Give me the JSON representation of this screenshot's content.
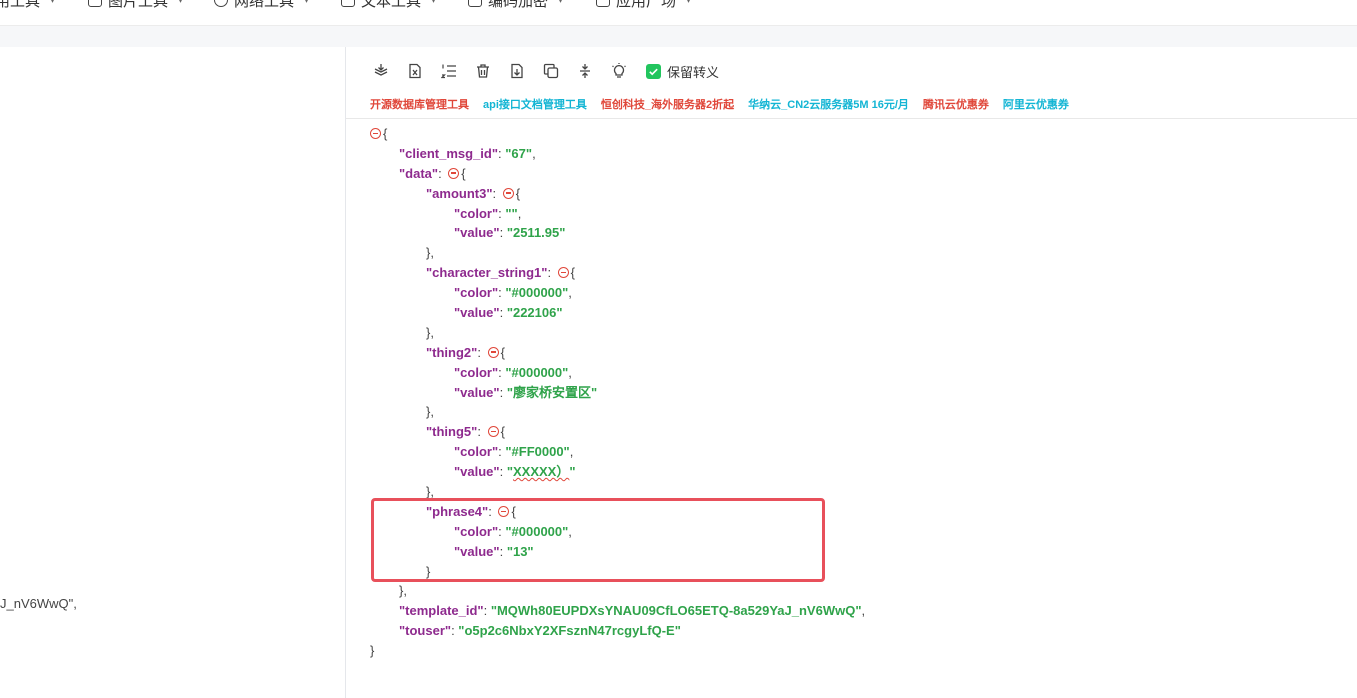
{
  "topnav": {
    "items": [
      {
        "label": "用工具",
        "icon": "toolbox-icon"
      },
      {
        "label": "图片工具",
        "icon": "image-icon"
      },
      {
        "label": "网络工具",
        "icon": "globe-icon"
      },
      {
        "label": "文本工具",
        "icon": "text-icon"
      },
      {
        "label": "编码加密",
        "icon": "lock-icon"
      },
      {
        "label": "应用广场",
        "icon": "grid-icon"
      }
    ]
  },
  "left_panel": {
    "visible_text": "J_nV6WwQ\","
  },
  "toolbar": {
    "buttons": [
      {
        "name": "compress-icon"
      },
      {
        "name": "excel-icon"
      },
      {
        "name": "list-icon"
      },
      {
        "name": "delete-icon"
      },
      {
        "name": "download-icon"
      },
      {
        "name": "copy-icon"
      },
      {
        "name": "collapse-icon"
      },
      {
        "name": "bulb-icon"
      }
    ],
    "keep_escape_label": "保留转义",
    "keep_escape_checked": true
  },
  "ads": [
    {
      "label": "开源数据库管理工具",
      "color": "#e0473a"
    },
    {
      "label": "api接口文档管理工具",
      "color": "#13b5d4"
    },
    {
      "label": "恒创科技_海外服务器2折起",
      "color": "#e0473a"
    },
    {
      "label": "华纳云_CN2云服务器5M 16元/月",
      "color": "#13b5d4"
    },
    {
      "label": "腾讯云优惠券",
      "color": "#e0473a"
    },
    {
      "label": "阿里云优惠券",
      "color": "#13b5d4"
    }
  ],
  "json_view": {
    "client_msg_id": {
      "key": "\"client_msg_id\"",
      "value": "\"67\""
    },
    "data_key": "\"data\"",
    "amount3": {
      "key": "\"amount3\"",
      "color_key": "\"color\"",
      "color_val": "\"\"",
      "value_key": "\"value\"",
      "value_val": "\"2511.95\""
    },
    "character_string1": {
      "key": "\"character_string1\"",
      "color_key": "\"color\"",
      "color_val": "\"#000000\"",
      "value_key": "\"value\"",
      "value_val": "\"222106\""
    },
    "thing2": {
      "key": "\"thing2\"",
      "color_key": "\"color\"",
      "color_val": "\"#000000\"",
      "value_key": "\"value\"",
      "value_val": "\"廖家桥安置区\""
    },
    "thing5": {
      "key": "\"thing5\"",
      "color_key": "\"color\"",
      "color_val": "\"#FF0000\"",
      "value_key": "\"value\"",
      "value_val_quote": "\"",
      "value_val_text": "XXXXX）",
      "value_val_end": "\""
    },
    "phrase4": {
      "key": "\"phrase4\"",
      "color_key": "\"color\"",
      "color_val": "\"#000000\"",
      "value_key": "\"value\"",
      "value_val": "\"13\""
    },
    "template_id": {
      "key": "\"template_id\"",
      "value": "\"MQWh80EUPDXsYNAU09CfLO65ETQ-8a529YaJ_nV6WwQ\""
    },
    "touser": {
      "key": "\"touser\"",
      "value": "\"o5p2c6NbxY2XFsznN47rcgyLfQ-E\""
    }
  },
  "colors": {
    "key": "#8e2a8e",
    "string": "#2fa34a",
    "toggle": "#e0473a",
    "highlight_border": "#e8505b",
    "checkbox": "#22c55e"
  }
}
